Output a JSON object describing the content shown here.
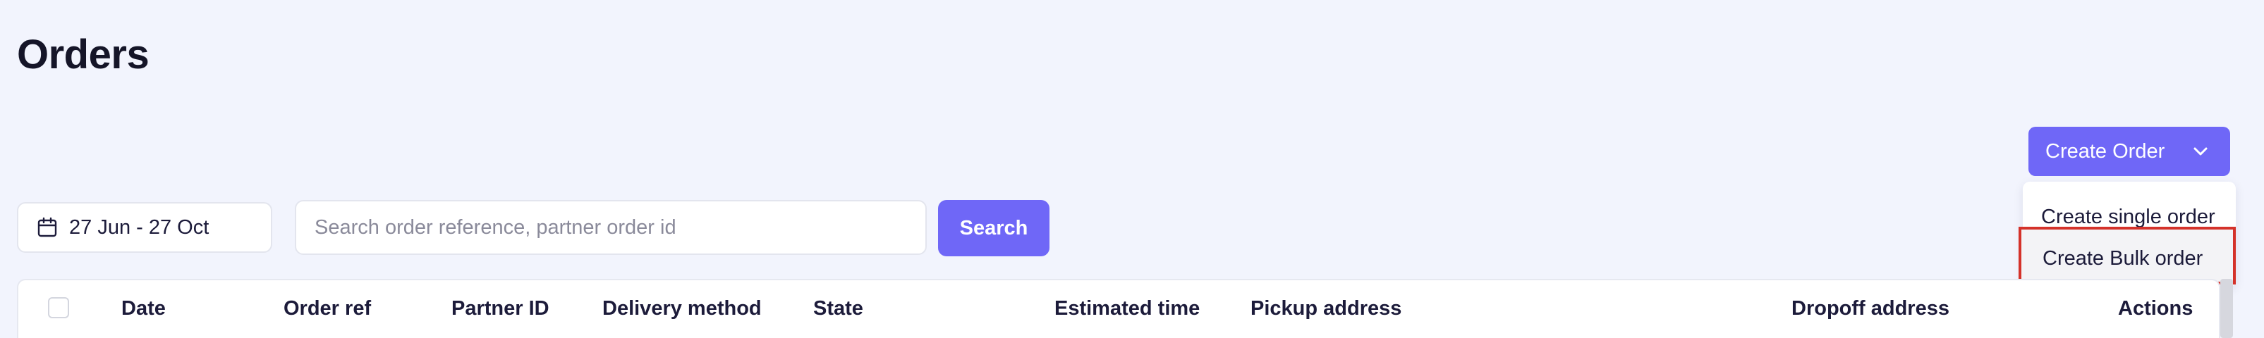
{
  "page": {
    "title": "Orders"
  },
  "create_order": {
    "label": "Create Order",
    "menu": [
      {
        "label": "Create single order"
      },
      {
        "label": "Create Bulk order"
      }
    ]
  },
  "filters": {
    "date_range": "27 Jun - 27 Oct",
    "search_placeholder": "Search order reference, partner order id",
    "search_value": "",
    "search_button": "Search"
  },
  "table": {
    "columns": [
      "Date",
      "Order ref",
      "Partner ID",
      "Delivery method",
      "State",
      "Estimated time",
      "Pickup address",
      "Dropoff address",
      "Actions"
    ]
  },
  "colors": {
    "accent": "#6f67f7",
    "highlight": "#d4322a",
    "background": "#f2f4fd"
  }
}
